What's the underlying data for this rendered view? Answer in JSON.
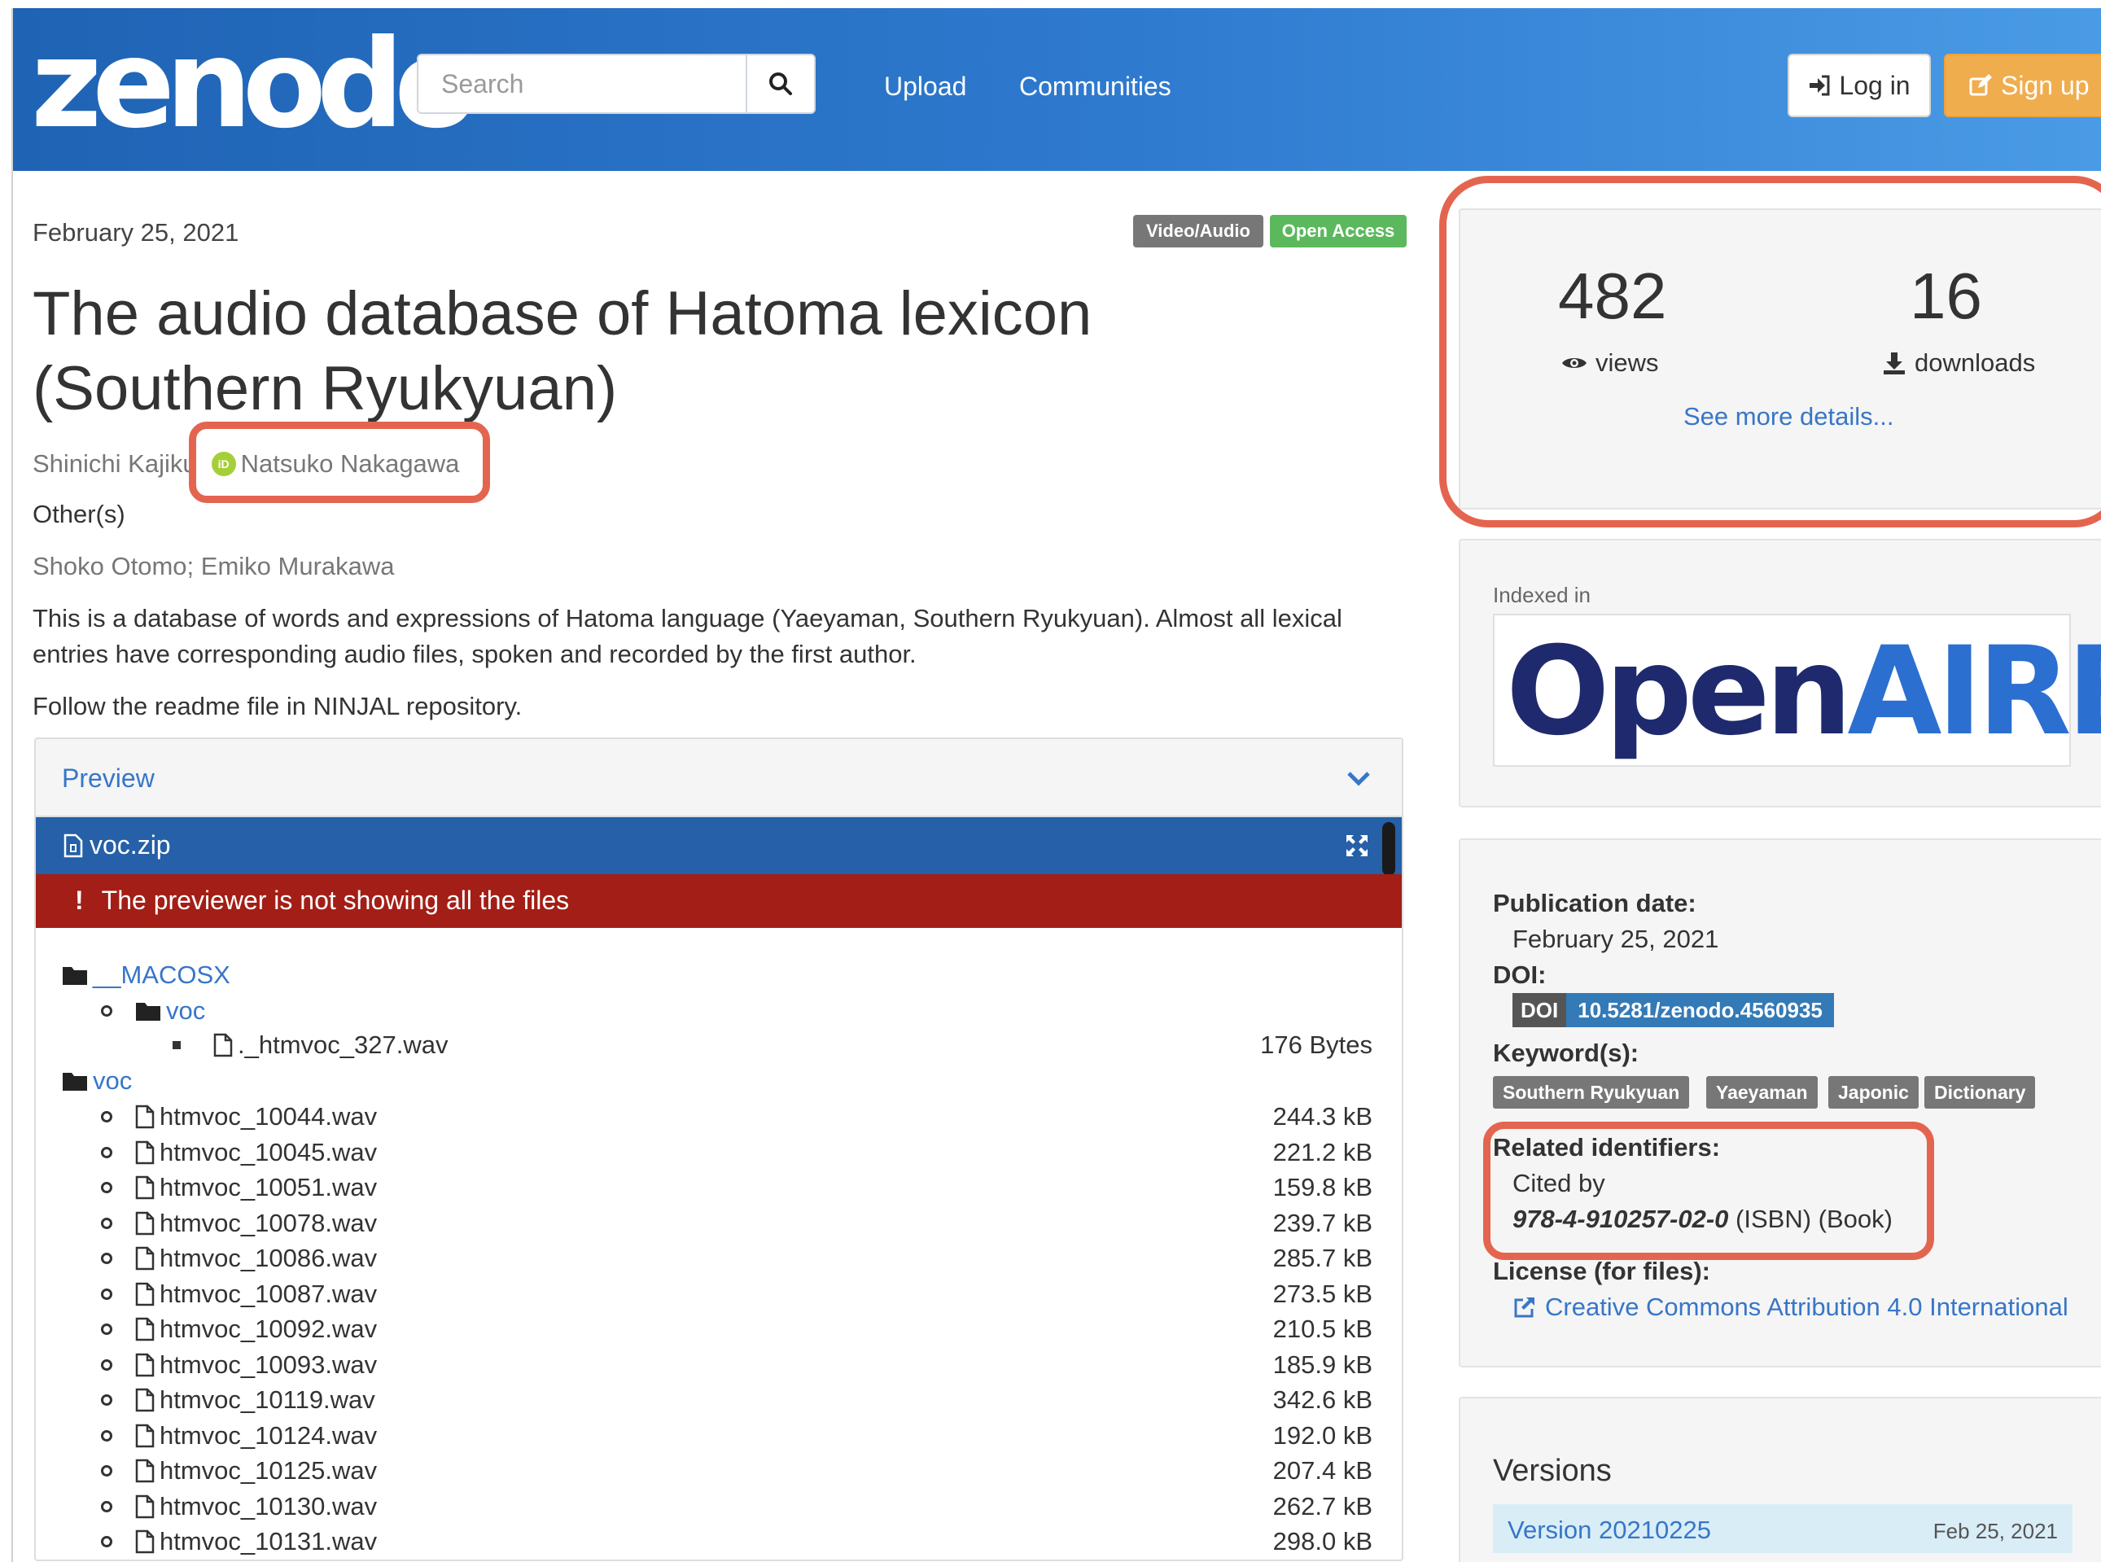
{
  "header": {
    "logo": "zenodo",
    "search_placeholder": "Search",
    "nav": [
      "Upload",
      "Communities"
    ],
    "login_label": "Log in",
    "signup_label": "Sign up",
    "colors": {
      "header_start": "#1f63b4",
      "header_end": "#4a9be6",
      "signup": "#f0ad4e"
    }
  },
  "record": {
    "date": "February 25, 2021",
    "badges": [
      "Video/Audio",
      "Open Access"
    ],
    "title_line1": "The audio database of Hatoma lexicon",
    "title_line2": "(Southern Ryukyuan)",
    "author1": "Shinichi Kajiku",
    "author2": "Natsuko Nakagawa",
    "others_label": "Other(s)",
    "others": "Shoko Otomo; Emiko Murakawa",
    "description": "This is a database of words and expressions of Hatoma language (Yaeyaman, Southern Ryukyuan). Almost all lexical entries have corresponding audio files, spoken and recorded by the first author.",
    "readme": "Follow the readme file in NINJAL repository."
  },
  "preview": {
    "title": "Preview",
    "file": "voc.zip",
    "alert": "The previewer is not showing all the files",
    "tree": {
      "macosx": "__MACOSX",
      "voc_sub": "voc",
      "hidden_file": "._htmvoc_327.wav",
      "hidden_size": "176 Bytes",
      "voc": "voc",
      "files": [
        {
          "name": "htmvoc_10044.wav",
          "size": "244.3 kB"
        },
        {
          "name": "htmvoc_10045.wav",
          "size": "221.2 kB"
        },
        {
          "name": "htmvoc_10051.wav",
          "size": "159.8 kB"
        },
        {
          "name": "htmvoc_10078.wav",
          "size": "239.7 kB"
        },
        {
          "name": "htmvoc_10086.wav",
          "size": "285.7 kB"
        },
        {
          "name": "htmvoc_10087.wav",
          "size": "273.5 kB"
        },
        {
          "name": "htmvoc_10092.wav",
          "size": "210.5 kB"
        },
        {
          "name": "htmvoc_10093.wav",
          "size": "185.9 kB"
        },
        {
          "name": "htmvoc_10119.wav",
          "size": "342.6 kB"
        },
        {
          "name": "htmvoc_10124.wav",
          "size": "192.0 kB"
        },
        {
          "name": "htmvoc_10125.wav",
          "size": "207.4 kB"
        },
        {
          "name": "htmvoc_10130.wav",
          "size": "262.7 kB"
        },
        {
          "name": "htmvoc_10131.wav",
          "size": "298.0 kB"
        }
      ]
    }
  },
  "stats": {
    "views": "482",
    "views_label": "views",
    "downloads": "16",
    "downloads_label": "downloads",
    "see_more": "See more details..."
  },
  "indexed": {
    "label": "Indexed in",
    "logo_open": "Open",
    "logo_aire": "AIRE"
  },
  "meta": {
    "pub_date_label": "Publication date:",
    "pub_date": "February 25, 2021",
    "doi_label": "DOI:",
    "doi_tag": "DOI",
    "doi_value": "10.5281/zenodo.4560935",
    "keywords_label": "Keyword(s):",
    "keywords": [
      "Southern Ryukyuan",
      "Yaeyaman",
      "Japonic",
      "Dictionary"
    ],
    "related_label": "Related identifiers:",
    "cited_by": "Cited by",
    "isbn": "978-4-910257-02-0",
    "isbn_suffix": " (ISBN) (Book)",
    "license_label": "License (for files):",
    "license": "Creative Commons Attribution 4.0 International"
  },
  "versions": {
    "title": "Versions",
    "version": "Version 20210225",
    "date": "Feb 25, 2021"
  }
}
